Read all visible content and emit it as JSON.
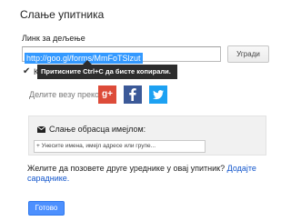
{
  "dialog": {
    "title": "Слање упитника"
  },
  "link": {
    "label": "Линк за дељење",
    "value": "http://goo.gl/forms/MmFoTSlzut",
    "embed_button": "Угради",
    "checkbox_label": "К",
    "tooltip": "Притисните Ctrl+C да бисте копирали."
  },
  "share": {
    "label": "Делите везу преко",
    "gplus_text": "g+",
    "icons": [
      "google-plus-icon",
      "facebook-icon",
      "twitter-icon"
    ]
  },
  "email": {
    "heading": "Слање обрасца имејлом:",
    "placeholder": "+ Унесите имена, имејл адресе или групе..."
  },
  "collaborators": {
    "question": "Желите да позовете друге уреднике у овај упитник?",
    "link": "Додајте сараднике."
  },
  "actions": {
    "done": "Готово"
  },
  "colors": {
    "primary": "#4d90fe",
    "link": "#1155cc",
    "selection": "#3399ff",
    "tooltip": "#2d2d2d"
  }
}
